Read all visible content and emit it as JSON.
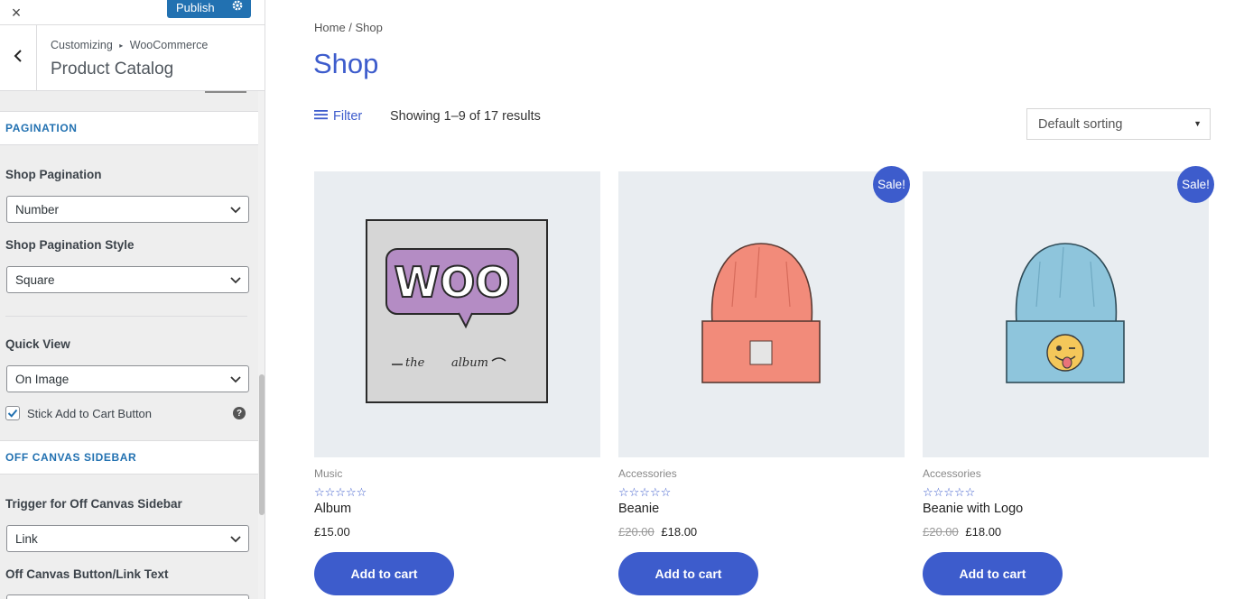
{
  "customizer": {
    "close_label": "×",
    "publish_label": "Publish",
    "breadcrumb_root": "Customizing",
    "breadcrumb_sep": "▸",
    "breadcrumb_parent": "WooCommerce",
    "section_title": "Product Catalog",
    "pagination_header": "PAGINATION",
    "shop_pagination_label": "Shop Pagination",
    "shop_pagination_value": "Number",
    "shop_pagination_style_label": "Shop Pagination Style",
    "shop_pagination_style_value": "Square",
    "quick_view_label": "Quick View",
    "quick_view_value": "On Image",
    "stick_cart_label": "Stick Add to Cart Button",
    "stick_cart_checked": true,
    "help_label": "?",
    "off_canvas_header": "OFF CANVAS SIDEBAR",
    "trigger_label": "Trigger for Off Canvas Sidebar",
    "trigger_value": "Link",
    "button_text_label": "Off Canvas Button/Link Text"
  },
  "shop": {
    "breadcrumb": "Home / Shop",
    "title": "Shop",
    "filter_label": "Filter",
    "result_count": "Showing 1–9 of 17 results",
    "sort_value": "Default sorting",
    "sort_caret": "▼",
    "products": [
      {
        "category": "Music",
        "stars": "☆☆☆☆☆",
        "name": "Album",
        "old_price": "",
        "price": "£15.00",
        "sale": "",
        "button": "Add to cart",
        "image": "album"
      },
      {
        "category": "Accessories",
        "stars": "☆☆☆☆☆",
        "name": "Beanie",
        "old_price": "£20.00",
        "price": "£18.00",
        "sale": "Sale!",
        "button": "Add to cart",
        "image": "beanie"
      },
      {
        "category": "Accessories",
        "stars": "☆☆☆☆☆",
        "name": "Beanie with Logo",
        "old_price": "£20.00",
        "price": "£18.00",
        "sale": "Sale!",
        "button": "Add to cart",
        "image": "beanie-with-logo"
      }
    ],
    "album_art": {
      "logo_text": "WOO",
      "subtitle_1": "the",
      "subtitle_2": "album"
    }
  },
  "colors": {
    "accent": "#3d5ccc",
    "wp_blue": "#2271b1",
    "beanie_red": "#f28b7a",
    "beanie_blue": "#8ec5dc",
    "woo_purple": "#b48cc4"
  }
}
